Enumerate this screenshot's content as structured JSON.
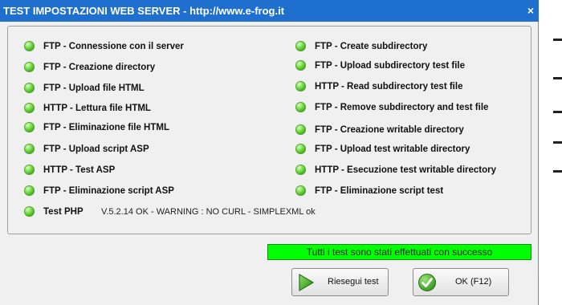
{
  "window": {
    "title": "TEST IMPOSTAZIONI WEB SERVER - http://www.e-frog.it",
    "close_glyph": "×"
  },
  "tests_left": [
    {
      "label": "FTP - Connessione con il server",
      "status": "ok"
    },
    {
      "label": "FTP - Creazione directory",
      "status": "ok"
    },
    {
      "label": "FTP - Upload file HTML",
      "status": "ok"
    },
    {
      "label": "HTTP - Lettura file HTML",
      "status": "ok"
    },
    {
      "label": "FTP - Eliminazione file HTML",
      "status": "ok"
    },
    {
      "label": "FTP - Upload script ASP",
      "status": "ok"
    },
    {
      "label": "HTTP - Test ASP",
      "status": "ok"
    },
    {
      "label": "FTP - Eliminazione script ASP",
      "status": "ok"
    },
    {
      "label": "Test PHP",
      "status": "ok"
    }
  ],
  "php_result": "V.5.2.14 OK - WARNING : NO CURL - SIMPLEXML ok",
  "tests_right": [
    {
      "label": "FTP - Create subdirectory",
      "status": "ok"
    },
    {
      "label": "FTP - Upload subdirectory test file",
      "status": "ok"
    },
    {
      "label": "HTTP - Read subdirectory test file",
      "status": "ok"
    },
    {
      "label": "FTP - Remove subdirectory and test file",
      "status": "ok"
    },
    {
      "label": "FTP - Creazione writable directory",
      "status": "ok"
    },
    {
      "label": "FTP - Upload test writable directory",
      "status": "ok"
    },
    {
      "label": "HTTP - Esecuzione test writable directory",
      "status": "ok"
    },
    {
      "label": "FTP - Eliminazione script test",
      "status": "ok"
    }
  ],
  "status_message": "Tutti i test sono stati effettuati con successo",
  "buttons": {
    "retry_label": "Riesegui test",
    "ok_label": "OK (F12)"
  },
  "icons": {
    "status_led": "green-led-icon",
    "retry": "play-arrow-icon",
    "ok": "green-check-icon"
  },
  "colors": {
    "titlebar": "#1e6fce",
    "status_bg": "#00ff00",
    "led_green": "#2f9a15"
  }
}
